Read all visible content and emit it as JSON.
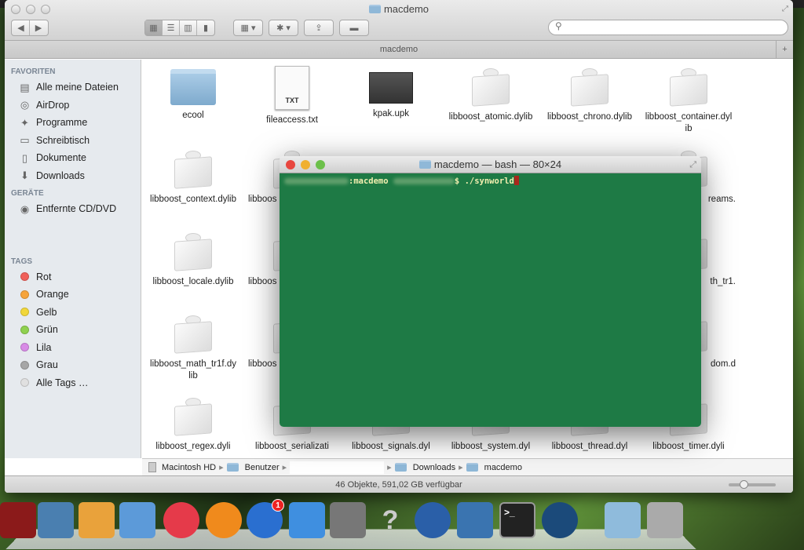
{
  "finder": {
    "title": "macdemo",
    "tab_label": "macdemo",
    "search_placeholder": "",
    "sidebar": {
      "favorites_header": "FAVORITEN",
      "favorites": [
        {
          "label": "Alle meine Dateien",
          "icon": "all-files-icon"
        },
        {
          "label": "AirDrop",
          "icon": "airdrop-icon"
        },
        {
          "label": "Programme",
          "icon": "applications-icon"
        },
        {
          "label": "Schreibtisch",
          "icon": "desktop-icon"
        },
        {
          "label": "Dokumente",
          "icon": "documents-icon"
        },
        {
          "label": "Downloads",
          "icon": "downloads-icon"
        }
      ],
      "devices_header": "GERÄTE",
      "devices": [
        {
          "label": "Entfernte CD/DVD",
          "icon": "disc-icon"
        }
      ],
      "tags_header": "TAGS",
      "tags": [
        {
          "label": "Rot",
          "color": "#f0605a"
        },
        {
          "label": "Orange",
          "color": "#f6a43a"
        },
        {
          "label": "Gelb",
          "color": "#f1d73a"
        },
        {
          "label": "Grün",
          "color": "#8fd14f"
        },
        {
          "label": "Lila",
          "color": "#d88be6"
        },
        {
          "label": "Grau",
          "color": "#a6a6a6"
        },
        {
          "label": "Alle Tags …",
          "color": "#e0e0e0"
        }
      ]
    },
    "items": [
      {
        "label": "ecool",
        "type": "folder"
      },
      {
        "label": "fileaccess.txt",
        "type": "txt",
        "badge": "TXT"
      },
      {
        "label": "kpak.upk",
        "type": "upk"
      },
      {
        "label": "libboost_atomic.dylib",
        "type": "dylib"
      },
      {
        "label": "libboost_chrono.dylib",
        "type": "dylib"
      },
      {
        "label": "libboost_container.dylib",
        "type": "dylib"
      },
      {
        "label": "libboost_context.dylib",
        "type": "dylib"
      },
      {
        "label": "libboos",
        "type": "dylib"
      },
      {
        "label": "reams.",
        "type": "dylib"
      },
      {
        "label": "libboost_locale.dylib",
        "type": "dylib"
      },
      {
        "label": "libboos",
        "type": "dylib"
      },
      {
        "label": "th_tr1.",
        "type": "dylib"
      },
      {
        "label": "libboost_math_tr1f.dylib",
        "type": "dylib"
      },
      {
        "label": "libboos",
        "type": "dylib"
      },
      {
        "label": "dom.d",
        "type": "dylib"
      },
      {
        "label": "libboost_regex.dyli",
        "type": "dylib"
      },
      {
        "label": "libboost_serializati",
        "type": "dylib"
      },
      {
        "label": "libboost_signals.dyl",
        "type": "dylib"
      },
      {
        "label": "libboost_system.dyl",
        "type": "dylib"
      },
      {
        "label": "libboost_thread.dyl",
        "type": "dylib"
      },
      {
        "label": "libboost_timer.dyli",
        "type": "dylib"
      }
    ],
    "path": [
      "Macintosh HD",
      "Benutzer",
      "",
      "Downloads",
      "macdemo"
    ],
    "status": "46 Objekte, 591,02 GB verfügbar",
    "icon_size_fraction": 0.3
  },
  "terminal": {
    "title": "macdemo — bash — 80×24",
    "prompt_dir": ":macdemo",
    "prompt_symbol": "$",
    "command": "./synworld",
    "bg_color": "#1e7a45"
  },
  "dock": {
    "apps": [
      "photo-booth",
      "iphoto",
      "pages",
      "numbers",
      "itunes",
      "ibooks",
      "app-store",
      "keynote",
      "system-preferences",
      "unknown-app",
      "quicktime",
      "python-launcher",
      "terminal",
      "steam",
      "downloads-stack",
      "trash"
    ],
    "app_store_badge": "1"
  }
}
